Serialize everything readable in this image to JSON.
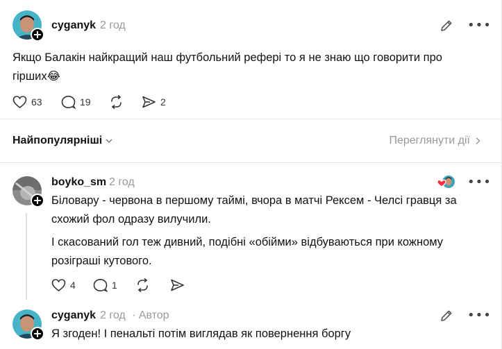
{
  "post": {
    "author": "cyganyk",
    "time": "2 год",
    "text": "Якщо Балакін найкращий наш футбольний рефері то я не знаю що говорити про гірших😂",
    "likes": "63",
    "replies": "19",
    "shares": "2"
  },
  "sort": {
    "label": "Найпопулярніші",
    "view_activity": "Переглянути дії"
  },
  "comments": [
    {
      "author": "boyko_sm",
      "time": "2 год",
      "paragraph1": "Біловару - червона в першому таймі, вчора в матчі Рексем - Челсі гравця за схожий фол одразу вилучили.",
      "paragraph2": "І скасований гол теж дивний, подібні «обійми» відбуваються при кожному розіграші кутового.",
      "likes": "4",
      "replies": "1"
    },
    {
      "author": "cyganyk",
      "time": "2 год",
      "author_tag": "· Автор",
      "text": "Я згоден! І пенальті потім виглядав як повернення боргу"
    }
  ],
  "colors": {
    "text": "#101010",
    "muted": "#999999",
    "divider": "#e5e5e5",
    "badge": "#000000"
  },
  "icons": [
    "plus-icon",
    "pencil-icon",
    "more-icon",
    "heart-icon",
    "comment-icon",
    "repost-icon",
    "share-icon",
    "chevron-down-icon",
    "chevron-right-icon",
    "liked-by-author-icon"
  ]
}
